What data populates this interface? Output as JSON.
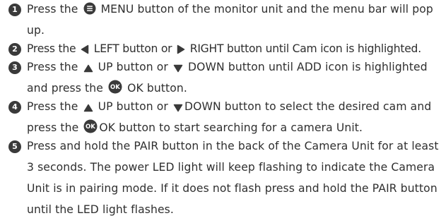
{
  "steps": [
    {
      "number": "1",
      "parts": {
        "a": "Press the ",
        "b": " MENU button of the monitor unit and the menu bar will pop up."
      },
      "icons": [
        "menu-icon"
      ]
    },
    {
      "number": "2",
      "parts": {
        "a": "Press the ",
        "b": " LEFT button or ",
        "c": " RIGHT button until  Cam icon is  highlighted."
      },
      "icons": [
        "left-arrow-icon",
        "right-arrow-icon"
      ]
    },
    {
      "number": "3",
      "parts": {
        "a": "Press the ",
        "b": " UP button or ",
        "c": " DOWN button until ADD icon is highlighted and press the ",
        "d": " OK button."
      },
      "icons": [
        "up-arrow-icon",
        "down-arrow-icon",
        "ok-icon"
      ]
    },
    {
      "number": "4",
      "parts": {
        "a": "Press the ",
        "b": " UP button or ",
        "c": "DOWN button to select the desired cam and press the ",
        "d": "OK button to start  searching for a camera Unit."
      },
      "icons": [
        "up-arrow-icon",
        "down-arrow-icon",
        "ok-icon"
      ]
    },
    {
      "number": "5",
      "parts": {
        "a": "Press and hold the PAIR button in the back of the Camera Unit for at  least 3 seconds. The power LED light will keep flashing to indicate the Camera Unit is in pairing mode. If it does not flash press and hold the PAIR button until the LED light flashes."
      },
      "icons": []
    }
  ],
  "icon_labels": {
    "ok": "OK"
  },
  "colors": {
    "text": "#2f2f2f",
    "icon": "#3a3a3a",
    "number_badge": "#3a3a3a"
  }
}
